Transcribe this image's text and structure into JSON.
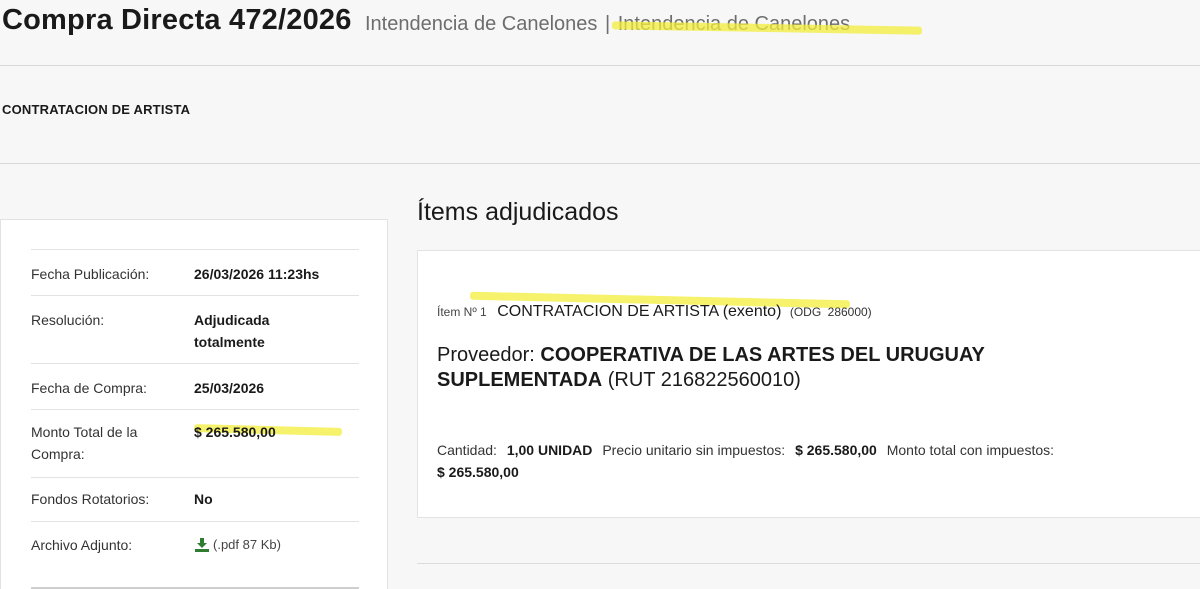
{
  "header": {
    "title": "Compra Directa 472/2026",
    "organism": "Intendencia de Canelones",
    "separator": "|",
    "unit": "Intendencia de Canelones"
  },
  "description": "CONTRATACION DE ARTISTA",
  "sidebar": {
    "rows": [
      {
        "label": "Fecha Publicación:",
        "value": "26/03/2026 11:23hs"
      },
      {
        "label": "Resolución:",
        "value": "Adjudicada totalmente"
      },
      {
        "label": "Fecha de Compra:",
        "value": "25/03/2026"
      },
      {
        "label": "Monto Total de la Compra:",
        "value": "$ 265.580,00"
      },
      {
        "label": "Fondos Rotatorios:",
        "value": "No"
      },
      {
        "label": "Archivo Adjunto:",
        "value": "(.pdf 87 Kb)",
        "icon": "download-icon"
      }
    ]
  },
  "awarded": {
    "section_title": "Ítems adjudicados",
    "item": {
      "number_label": "Ítem Nº 1",
      "name": "CONTRATACION DE ARTISTA (exento)",
      "odg_label": "(ODG",
      "odg_code": "286000)",
      "provider_label": "Proveedor:",
      "provider_name": "COOPERATIVA DE LAS ARTES DEL URUGUAY SUPLEMENTADA",
      "provider_rut": "(RUT 216822560010)",
      "quantity_label": "Cantidad:",
      "quantity_value": "1,00 UNIDAD",
      "unit_price_label": "Precio unitario sin impuestos:",
      "unit_price_value": "$ 265.580,00",
      "total_label": "Monto total con impuestos:",
      "total_value": "$ 265.580,00"
    }
  },
  "colors": {
    "highlight": "#f3ee3a",
    "download_icon": "#2e7d32"
  }
}
